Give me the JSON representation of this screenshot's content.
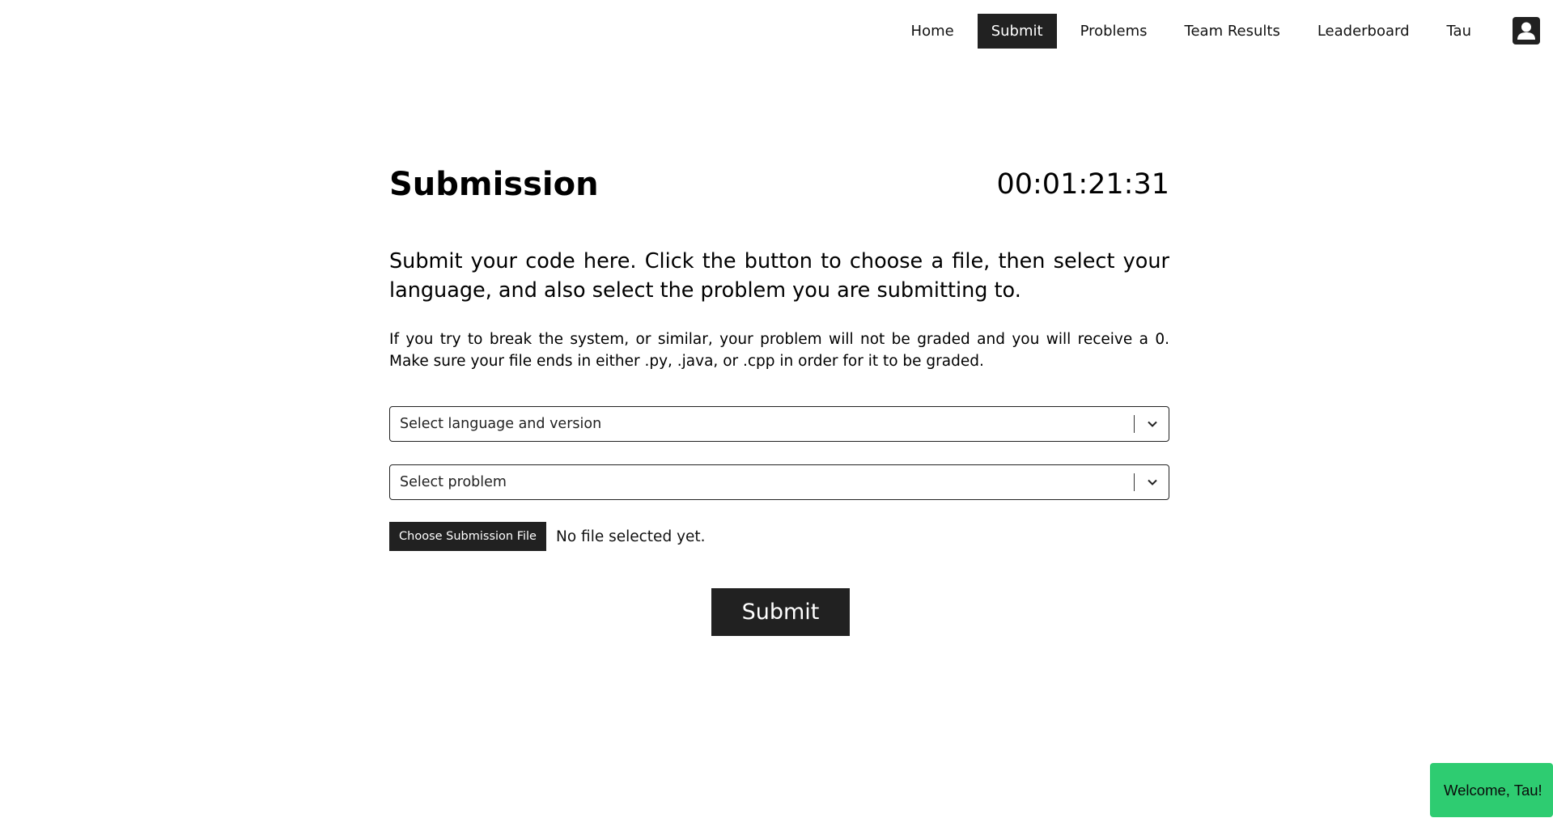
{
  "nav": {
    "items": [
      {
        "label": "Home",
        "active": false
      },
      {
        "label": "Submit",
        "active": true
      },
      {
        "label": "Problems",
        "active": false
      },
      {
        "label": "Team Results",
        "active": false
      },
      {
        "label": "Leaderboard",
        "active": false
      },
      {
        "label": "Tau",
        "active": false
      }
    ],
    "profile_icon": "user-account-icon"
  },
  "page": {
    "title": "Submission",
    "timer": "00:01:21:31",
    "lead": "Submit your code here. Click the button to choose a file, then select your language, and also select the problem you are submitting to.",
    "note": "If you try to break the system, or similar, your problem will not be graded and you will receive a 0. Make sure your file ends in either .py, .java, or .cpp in order for it to be graded."
  },
  "form": {
    "language_placeholder": "Select language and version",
    "problem_placeholder": "Select problem",
    "choose_file_label": "Choose Submission File",
    "file_status": "No file selected yet.",
    "submit_label": "Submit"
  },
  "toast": {
    "message": "Welcome, Tau!"
  },
  "colors": {
    "dark": "#212121",
    "toast_green": "#2ecc71",
    "background": "#ffffff"
  }
}
